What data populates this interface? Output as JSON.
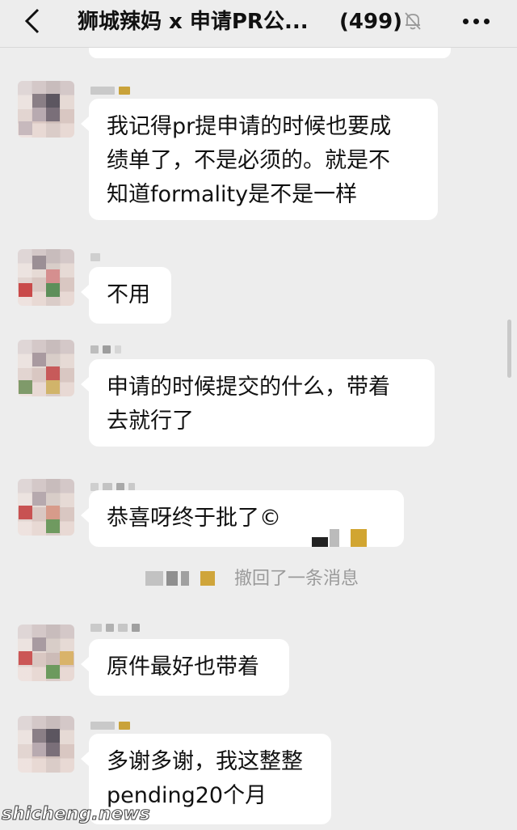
{
  "header": {
    "title": "狮城辣妈 x 申请PR公...",
    "member_count": "(499)"
  },
  "messages": [
    {
      "id": "m1",
      "text_lines": [
        "我记得pr提申请的时候也要成",
        "绩单了，不是必须的。就是不",
        "知道formality是不是一样"
      ]
    },
    {
      "id": "m2",
      "text_lines": [
        "不用"
      ]
    },
    {
      "id": "m3",
      "text_lines": [
        "申请的时候提交的什么，带着",
        "去就行了"
      ]
    },
    {
      "id": "m4",
      "text_lines": [
        "恭喜呀终于批了"
      ],
      "trailing_glyph": "©"
    },
    {
      "id": "m5",
      "text_lines": [
        "原件最好也带着"
      ]
    },
    {
      "id": "m6",
      "text_lines": [
        "多谢多谢，我这整整",
        "pending20个月"
      ]
    }
  ],
  "system_notice": {
    "text": "撤回了一条消息"
  },
  "watermark": "shicheng.news",
  "icons": {
    "back": "chevron-left-icon",
    "mute": "bell-off-icon",
    "more": "more-dots-icon"
  },
  "colors": {
    "background": "#ededed",
    "bubble": "#ffffff",
    "system_text": "#9a9a9a"
  }
}
